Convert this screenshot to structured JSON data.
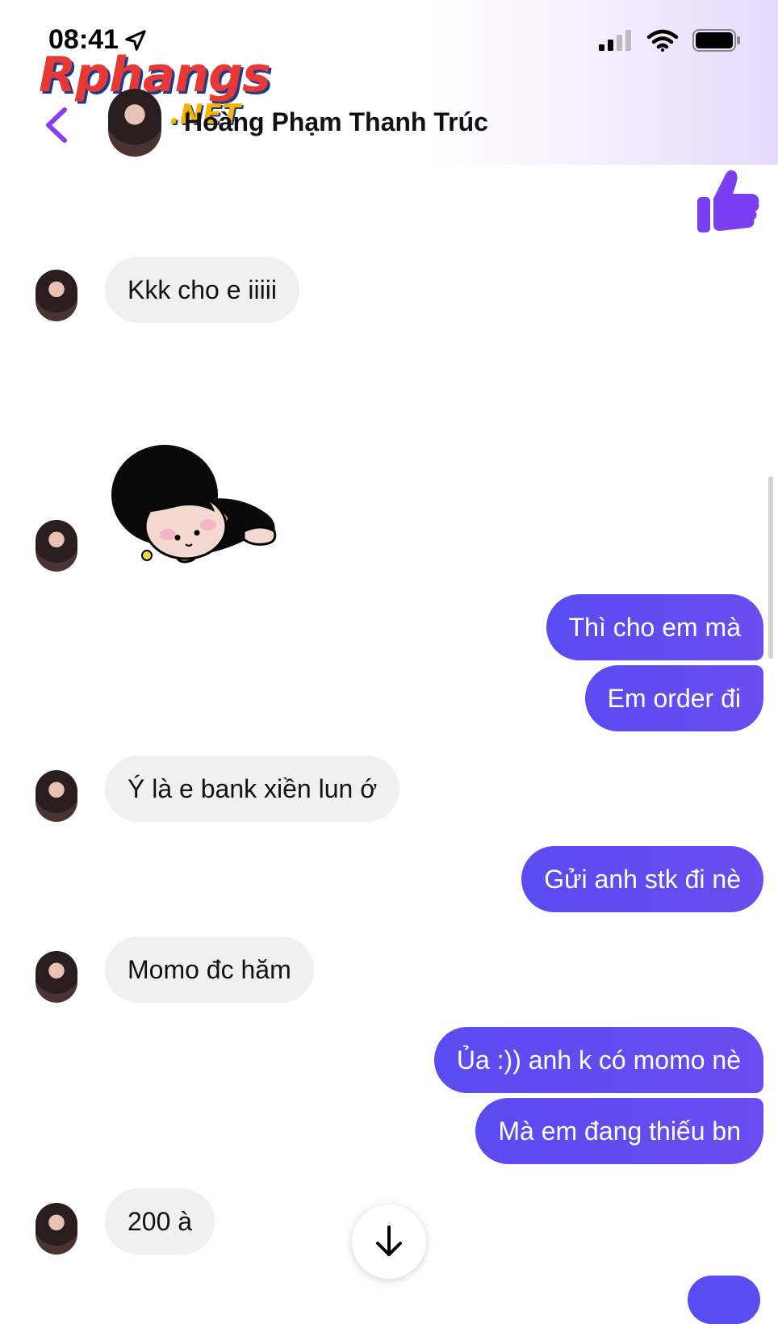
{
  "status_bar": {
    "time": "08:41",
    "icons": [
      "location-arrow-icon",
      "cellular-signal-icon",
      "wifi-icon",
      "battery-icon"
    ]
  },
  "watermark": {
    "main": "Rphangs",
    "suffix": ".NET"
  },
  "header": {
    "back_icon": "chevron-left-icon",
    "contact_name": "Hoàng Phạm Thanh Trúc"
  },
  "messages": [
    {
      "from": "them",
      "type": "text",
      "text": "Kkk cho e iiiii"
    },
    {
      "from": "them",
      "type": "sticker",
      "sticker": "sleeping-girl-sticker"
    },
    {
      "from": "me",
      "type": "text",
      "text": "Thì cho em mà"
    },
    {
      "from": "me",
      "type": "text",
      "text": "Em order đi"
    },
    {
      "from": "them",
      "type": "text",
      "text": "Ý là e bank xiền lun ớ"
    },
    {
      "from": "me",
      "type": "text",
      "text": "Gửi anh stk đi nè"
    },
    {
      "from": "them",
      "type": "text",
      "text": "Momo đc hăm"
    },
    {
      "from": "me",
      "type": "text",
      "text": "Ủa :)) anh k có momo nè"
    },
    {
      "from": "me",
      "type": "text",
      "text": "Mà em đang thiếu bn"
    },
    {
      "from": "them",
      "type": "text",
      "text": "200 à"
    }
  ],
  "colors": {
    "accent": "#5a4cf0",
    "incoming_bubble": "#f0f0f0",
    "like": "#7b3ff2"
  }
}
